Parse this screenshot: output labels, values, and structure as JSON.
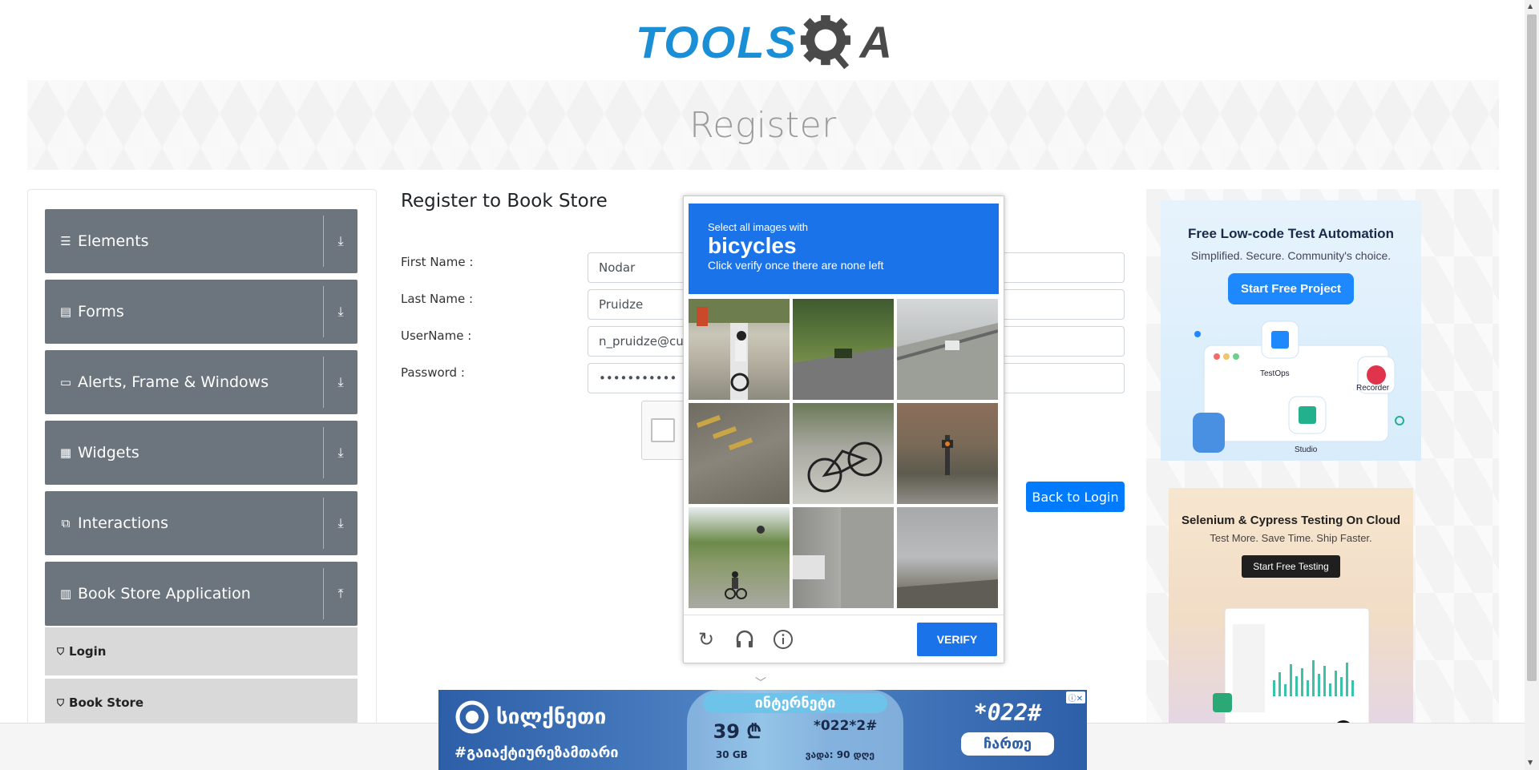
{
  "header": {
    "logo_text": "TOOLS",
    "logo_q": "Q",
    "logo_a": "A"
  },
  "banner": {
    "title": "Register"
  },
  "sidebar": {
    "groups": [
      {
        "label": "Elements",
        "icon": "menu-icon",
        "toggle": "expand-down-icon"
      },
      {
        "label": "Forms",
        "icon": "document-icon",
        "toggle": "expand-down-icon"
      },
      {
        "label": "Alerts, Frame & Windows",
        "icon": "window-icon",
        "toggle": "expand-down-icon"
      },
      {
        "label": "Widgets",
        "icon": "widgets-icon",
        "toggle": "expand-down-icon"
      },
      {
        "label": "Interactions",
        "icon": "interactions-icon",
        "toggle": "expand-down-icon"
      },
      {
        "label": "Book Store Application",
        "icon": "books-icon",
        "toggle": "collapse-up-icon"
      }
    ],
    "subitems": [
      {
        "label": "Login",
        "icon": "html5-icon"
      },
      {
        "label": "Book Store",
        "icon": "html5-icon"
      }
    ]
  },
  "form": {
    "title": "Register to Book Store",
    "first_name_label": "First Name :",
    "first_name_value": "Nodar",
    "last_name_label": "Last Name :",
    "last_name_value": "Pruidze",
    "username_label": "UserName :",
    "username_value": "n_pruidze@cu.",
    "password_label": "Password :",
    "password_value": "•••••••••••",
    "back_button": "Back to Login"
  },
  "challenge": {
    "line1": "Select all images with",
    "target": "bicycles",
    "line3": "Click verify once there are none left",
    "verify_button": "VERIFY",
    "footer_icons": [
      "reload-icon",
      "audio-icon",
      "info-icon"
    ]
  },
  "ads": {
    "ad1": {
      "title": "Free Low-code Test Automation",
      "subtitle": "Simplified. Secure. Community's choice.",
      "button": "Start Free Project",
      "labels": [
        "TestOps",
        "Recorder",
        "Studio"
      ]
    },
    "ad2": {
      "title": "Selenium & Cypress Testing On Cloud",
      "subtitle": "Test More. Save Time. Ship Faster.",
      "button": "Start Free Testing"
    },
    "bottom": {
      "brand": "სილქნეთი",
      "hashtag": "#გაიაქტიურეზამთარი",
      "header": "ინტერნეტი",
      "price": "39 ₾",
      "code1": "*022*2#",
      "data": "30 GB",
      "validity": "ვადა: 90 დღე",
      "code_big": "*022#",
      "cta": "ჩართე"
    }
  },
  "colors": {
    "nav_bg": "#6c757d",
    "subitem_bg": "#d9d9d9",
    "primary_blue": "#007bff",
    "captcha_blue": "#1a73e8",
    "logo_blue": "#1b8fd6"
  }
}
